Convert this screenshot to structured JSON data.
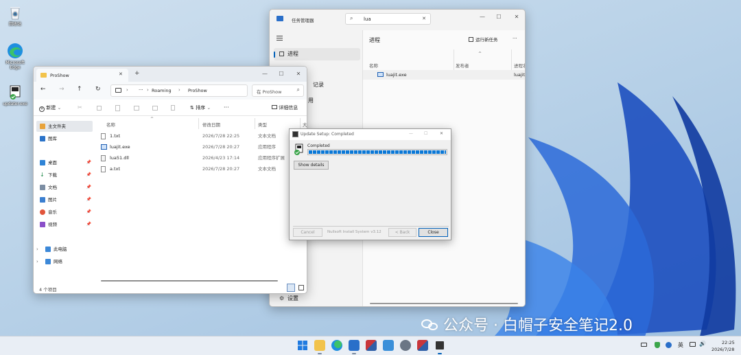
{
  "desktop": {
    "icons": [
      {
        "label": "回收站"
      },
      {
        "label": "Microsoft Edge"
      },
      {
        "label": "updater.exe"
      }
    ],
    "watermark": "公众号 · 白帽子安全笔记2.0"
  },
  "taskmgr": {
    "title": "任务管理器",
    "search_value": "lua",
    "search_clear": "✕",
    "menu_icon": "hamburger-icon",
    "sidebar": {
      "processes": "进程",
      "history": "记录",
      "extra": "用",
      "settings": "设置"
    },
    "header": {
      "title": "进程",
      "run_new_task": "运行新任务",
      "more": "···"
    },
    "columns": {
      "name": "名称",
      "publisher": "发布者",
      "pid": "进程名",
      "sort_arrow": "^"
    },
    "rows": [
      {
        "name": "luajit.exe",
        "pid": "luajit.exe"
      }
    ]
  },
  "explorer": {
    "tab_title": "ProShow",
    "new_tab": "+",
    "address": {
      "sep": "···",
      "crumbs": [
        "Roaming",
        "ProShow"
      ],
      "chevron": "›"
    },
    "search_placeholder": "在 ProShow",
    "toolbar": {
      "new": "新建",
      "sort": "排序",
      "more": "···",
      "details": "详细信息"
    },
    "nav": {
      "home": "主文件夹",
      "gallery": "图库",
      "desktop": "桌面",
      "downloads": "下载",
      "documents": "文档",
      "pictures": "图片",
      "music": "音乐",
      "videos": "视频",
      "this_pc": "此电脑",
      "network": "网络"
    },
    "columns": {
      "name": "名称",
      "date": "修改日期",
      "type": "类型",
      "size": "大"
    },
    "files": [
      {
        "name": "1.txt",
        "date": "2026/7/28 22:25",
        "type": "文本文档"
      },
      {
        "name": "luajit.exe",
        "date": "2026/7/28 20:27",
        "type": "应用程序"
      },
      {
        "name": "lua51.dll",
        "date": "2026/4/23 17:14",
        "type": "应用程序扩展"
      },
      {
        "name": "a.txt",
        "date": "2026/7/28 20:27",
        "type": "文本文档"
      }
    ],
    "status": "4 个项目"
  },
  "nsis": {
    "title": "Update Setup: Completed",
    "status": "Completed",
    "progress": 1.0,
    "show_details": "Show details",
    "cancel": "Cancel",
    "brand": "Nullsoft Install System v3.12",
    "back": "< Back",
    "close": "Close"
  },
  "taskbar": {
    "tray": {
      "ime": "英",
      "time": "22:25",
      "date": "2026/7/28"
    }
  },
  "colors": {
    "accent": "#005fb8",
    "progress": "#0a78d7",
    "selected": "#dde3ea",
    "taskbar": "#e9eef5"
  }
}
